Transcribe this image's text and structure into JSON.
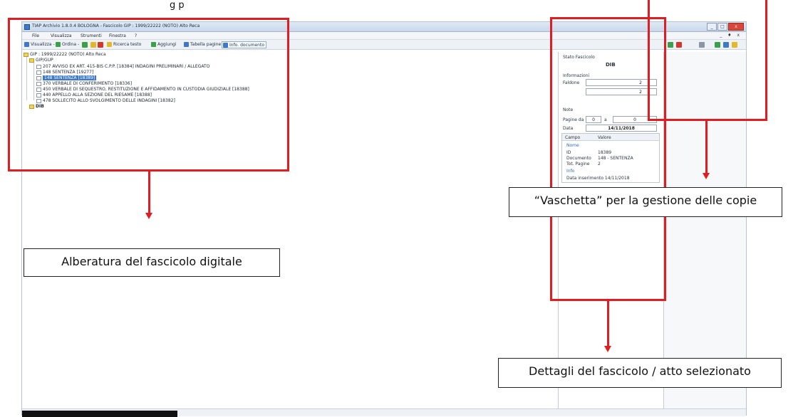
{
  "page_caption": "g   p",
  "window": {
    "title": "TIAP Archivio 1.8.0.4 BOLOGNA - Fascicolo GIP : 1999/22222 (NOTO) Alto Reca",
    "controls": [
      "_",
      "□",
      "x"
    ]
  },
  "menu": {
    "items": [
      "File",
      "Visualizza",
      "Strumenti",
      "Finestra",
      "?"
    ],
    "mdi_controls": "_ ♦ x"
  },
  "toolbar": {
    "buttons": [
      "Visualizza -",
      "Ordina -",
      "Ricerca testo",
      "Aggiungi",
      "Tabella pagine",
      "Info. documento"
    ],
    "colors": {
      "accent": "#3d79c8",
      "green": "#3aa04a",
      "red": "#d7372b",
      "yellow": "#e3b829"
    }
  },
  "tree": {
    "root": "GIP : 1999/22222 (NOTO) Alto Reca",
    "folder": "GIP/GUP",
    "items": [
      "207 AVVISO EX ART. 415-BIS C.P.P. [18384] INDAGINI PRELIMINARI / ALLEGATO",
      "148 SENTENZA [19277]",
      "148 SENTENZA [18389]",
      "370 VERBALE DI CONFERIMENTO [18336]",
      "450 VERBALE DI SEQUESTRO, RESTITUZIONE E AFFIDAMENTO IN CUSTODIA GIUDIZIALE [18388]",
      "440 APPELLO ALLA SEZIONE DEL RIESAME [18388]",
      "478 SOLLECITO ALLO SVOLGIMENTO DELLE INDAGINI [18382]"
    ],
    "second_folder": "DIB"
  },
  "details": {
    "stato_label": "Stato Fascicolo",
    "stato_value": "DIB",
    "info_label": "Informazioni",
    "faldone_label": "Faldone",
    "faldone_value": "2",
    "faldone_value2": "2",
    "note_label": "Note",
    "pagine_label": "Pagine da",
    "pagine_from": "0",
    "pagine_a": "a",
    "pagine_to": "0",
    "data_label": "Data",
    "data_value": "14/11/2018",
    "grid_headers": [
      "Campo",
      "Valore"
    ],
    "grid_section": "Nome",
    "grid_rows": [
      {
        "k": "ID",
        "v": "18389"
      },
      {
        "k": "Documento",
        "v": "148 - SENTENZA"
      },
      {
        "k": "Tot. Pagine",
        "v": "2"
      }
    ],
    "grid_section2": "Info",
    "grid_last": "Data inserimento  14/11/2018"
  },
  "annotations": {
    "tree_label": "Alberatura del fascicolo digitale",
    "copies_label": "“Vaschetta” per la gestione delle copie",
    "details_label": "Dettagli del fascicolo / atto selezionato",
    "color": "#e21c21"
  }
}
